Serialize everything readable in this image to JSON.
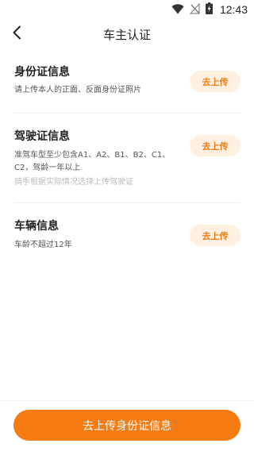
{
  "status_bar": {
    "time": "12:43",
    "icons": [
      "wifi-icon",
      "no-signal-icon",
      "battery-charging-icon"
    ]
  },
  "header": {
    "title": "车主认证",
    "back_icon": "chevron-left-icon"
  },
  "sections": [
    {
      "title": "身份证信息",
      "description": "请上传本人的正面、反面身份证照片",
      "button_label": "去上传"
    },
    {
      "title": "驾驶证信息",
      "description": "准驾车型至少包含A1、A2、B1、B2、C1、C2，驾龄一年以上",
      "hint": "骑手根据实际情况选择上传驾驶证",
      "button_label": "去上传"
    },
    {
      "title": "车辆信息",
      "description": "车龄不超过12年",
      "button_label": "去上传"
    }
  ],
  "footer": {
    "primary_button_label": "去上传身份证信息"
  },
  "colors": {
    "accent": "#f77b13",
    "button_bg": "#fff0e0",
    "button_text": "#f47b14"
  }
}
